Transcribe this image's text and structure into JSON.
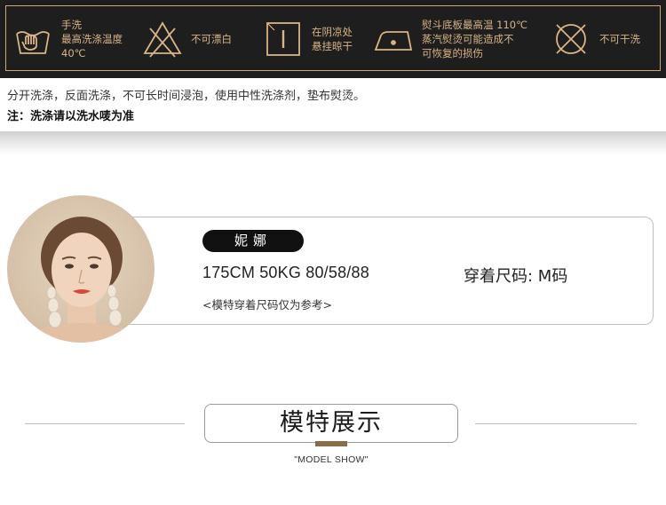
{
  "care_labels": [
    {
      "icon": "hand-wash-icon",
      "text": "手洗\n最高洗涤温度\n40℃"
    },
    {
      "icon": "no-bleach-icon",
      "text": "不可漂白"
    },
    {
      "icon": "line-dry-shade-icon",
      "text": "在阴凉处\n悬挂晾干"
    },
    {
      "icon": "iron-icon",
      "text": "熨斗底板最高温 110℃\n蒸汽熨烫可能造成不\n可恢复的损伤"
    },
    {
      "icon": "no-dry-clean-icon",
      "text": "不可干洗"
    }
  ],
  "instructions": {
    "wash": "分开洗涤，反面洗涤，不可长时间浸泡，使用中性洗涤剂，垫布熨烫。",
    "note": "注：洗涤请以洗水唛为准"
  },
  "model": {
    "name": "妮娜",
    "stats": "175CM 50KG  80/58/88",
    "size_worn": "穿着尺码: M码",
    "note": "<模特穿着尺码仅为参考>"
  },
  "section": {
    "title": "模特展示",
    "subtitle": "\"MODEL SHOW\""
  },
  "colors": {
    "care_bar": "#1e1e1e",
    "gold": "#d9b487",
    "accent": "#8e6a48"
  }
}
